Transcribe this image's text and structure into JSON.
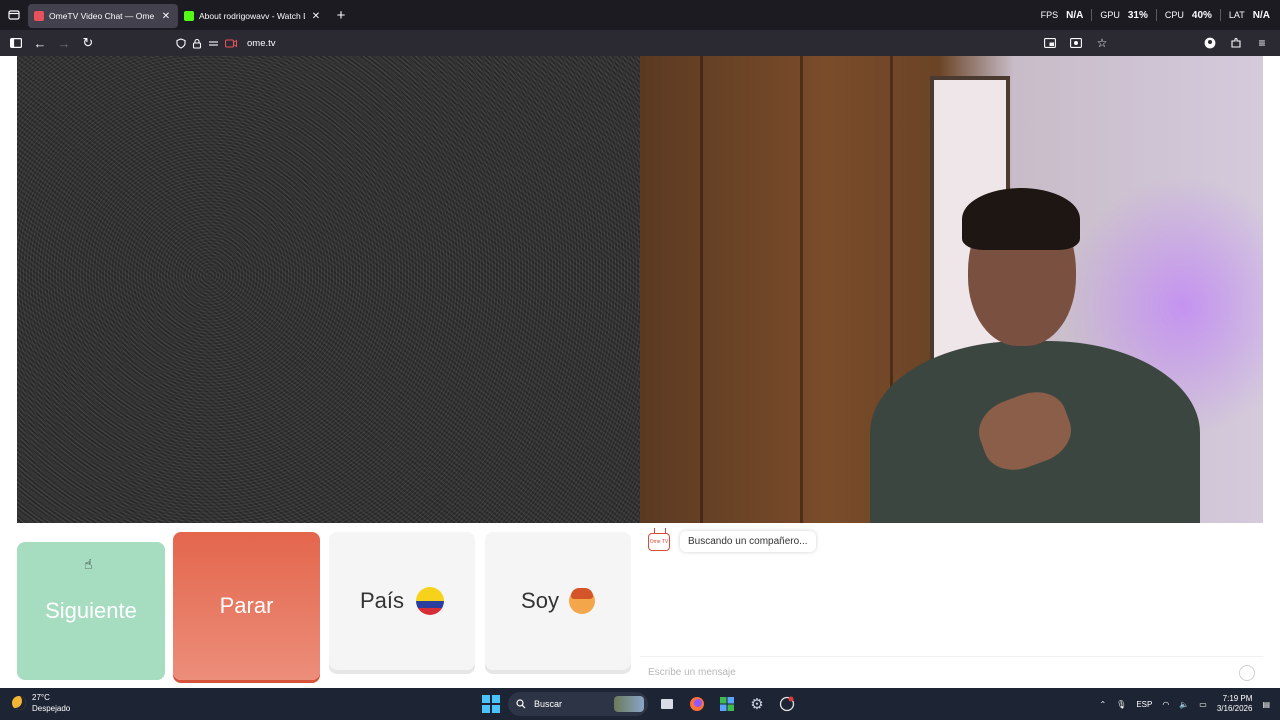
{
  "browser": {
    "tabs": [
      {
        "title": "OmeTV Video Chat — Ome",
        "active": true,
        "favicon_color": "#e8505b"
      },
      {
        "title": "About rodrigowavv - Watch Liv",
        "active": false,
        "favicon_color": "#53fc18"
      }
    ],
    "new_tab": "+",
    "stats": {
      "fps_label": "FPS",
      "fps_value": "N/A",
      "gpu_label": "GPU",
      "gpu_value": "31%",
      "cpu_label": "CPU",
      "cpu_value": "40%",
      "lat_label": "LAT",
      "lat_value": "N/A"
    },
    "url": "ome.tv"
  },
  "controls": {
    "next_label": "Siguiente",
    "stop_label": "Parar",
    "country_label": "País",
    "gender_label": "Soy"
  },
  "chat": {
    "status_message": "Buscando un compañero...",
    "tv_icon_text": "Ome TV",
    "input_placeholder": "Escribe un mensaje"
  },
  "taskbar": {
    "weather_temp": "27°C",
    "weather_desc": "Despejado",
    "search_label": "Buscar",
    "language": "ESP",
    "time": "7:19 PM",
    "date": "3/16/2026"
  }
}
